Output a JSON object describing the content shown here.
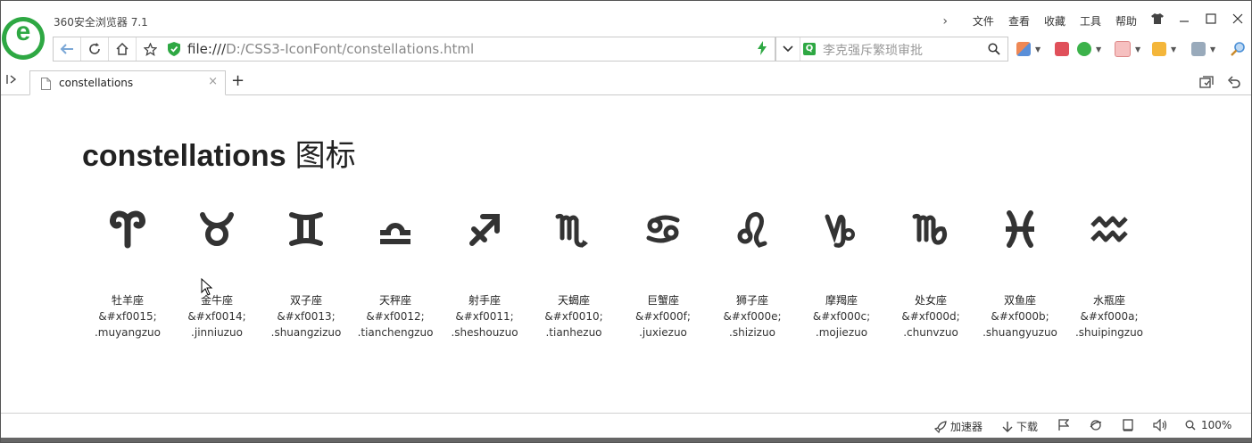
{
  "browser": {
    "app_title": "360安全浏览器 7.1",
    "logo_letter": "e",
    "menu": [
      "文件",
      "查看",
      "收藏",
      "工具",
      "帮助"
    ]
  },
  "address_bar": {
    "url_prefix": "file:///",
    "url_rest": "D:/CSS3-IconFont/constellations.html"
  },
  "search": {
    "engine_letter": "Q",
    "query": "李克强斥繁琐审批"
  },
  "tab": {
    "title": "constellations"
  },
  "page": {
    "heading_en": "constellations",
    "heading_zh": "图标",
    "icons": [
      {
        "name": "牡羊座",
        "code": "&#xf0015;",
        "cls": ".muyangzuo",
        "symbol": "aries-icon"
      },
      {
        "name": "金牛座",
        "code": "&#xf0014;",
        "cls": ".jinniuzuo",
        "symbol": "taurus-icon"
      },
      {
        "name": "双子座",
        "code": "&#xf0013;",
        "cls": ".shuangzizuo",
        "symbol": "gemini-icon"
      },
      {
        "name": "天秤座",
        "code": "&#xf0012;",
        "cls": ".tianchengzuo",
        "symbol": "libra-icon"
      },
      {
        "name": "射手座",
        "code": "&#xf0011;",
        "cls": ".sheshouzuo",
        "symbol": "sagittarius-icon"
      },
      {
        "name": "天蝎座",
        "code": "&#xf0010;",
        "cls": ".tianhezuo",
        "symbol": "scorpio-icon"
      },
      {
        "name": "巨蟹座",
        "code": "&#xf000f;",
        "cls": ".juxiezuo",
        "symbol": "cancer-icon"
      },
      {
        "name": "狮子座",
        "code": "&#xf000e;",
        "cls": ".shizizuo",
        "symbol": "leo-icon"
      },
      {
        "name": "摩羯座",
        "code": "&#xf000c;",
        "cls": ".mojiezuo",
        "symbol": "capricorn-icon"
      },
      {
        "name": "处女座",
        "code": "&#xf000d;",
        "cls": ".chunvzuo",
        "symbol": "virgo-icon"
      },
      {
        "name": "双鱼座",
        "code": "&#xf000b;",
        "cls": ".shuangyuzuo",
        "symbol": "pisces-icon"
      },
      {
        "name": "水瓶座",
        "code": "&#xf000a;",
        "cls": ".shuipingzuo",
        "symbol": "aquarius-icon"
      }
    ]
  },
  "status_bar": {
    "accelerator": "加速器",
    "download": "下载",
    "zoom": "100%"
  },
  "colors": {
    "brand_green": "#2ea843",
    "glyph": "#333333"
  }
}
